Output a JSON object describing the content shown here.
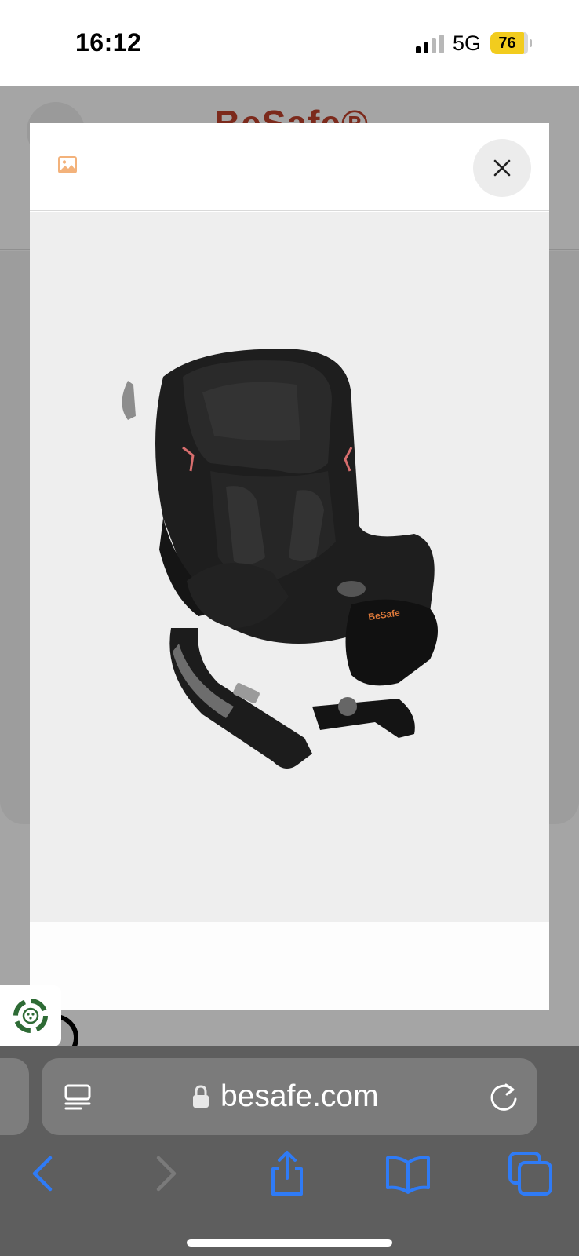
{
  "status_bar": {
    "time": "16:12",
    "network": "5G",
    "battery": "76"
  },
  "background_page": {
    "logo_text": "BeSafe®"
  },
  "modal": {
    "header_icon": "image-icon",
    "close_icon": "close-icon",
    "product_image": "car-seat",
    "brand_mark_on_product": "BeSafe"
  },
  "browser": {
    "url": "besafe.com",
    "icons": [
      "reader-icon",
      "lock-icon",
      "reload-icon",
      "back-icon",
      "forward-icon",
      "share-icon",
      "bookmarks-icon",
      "tabs-icon"
    ]
  },
  "colors": {
    "accent_blue": "#2f7bf6",
    "badge_green": "#2e6b35",
    "battery_yellow": "#f2cc1e",
    "image_icon_orange": "#f3b27b"
  }
}
